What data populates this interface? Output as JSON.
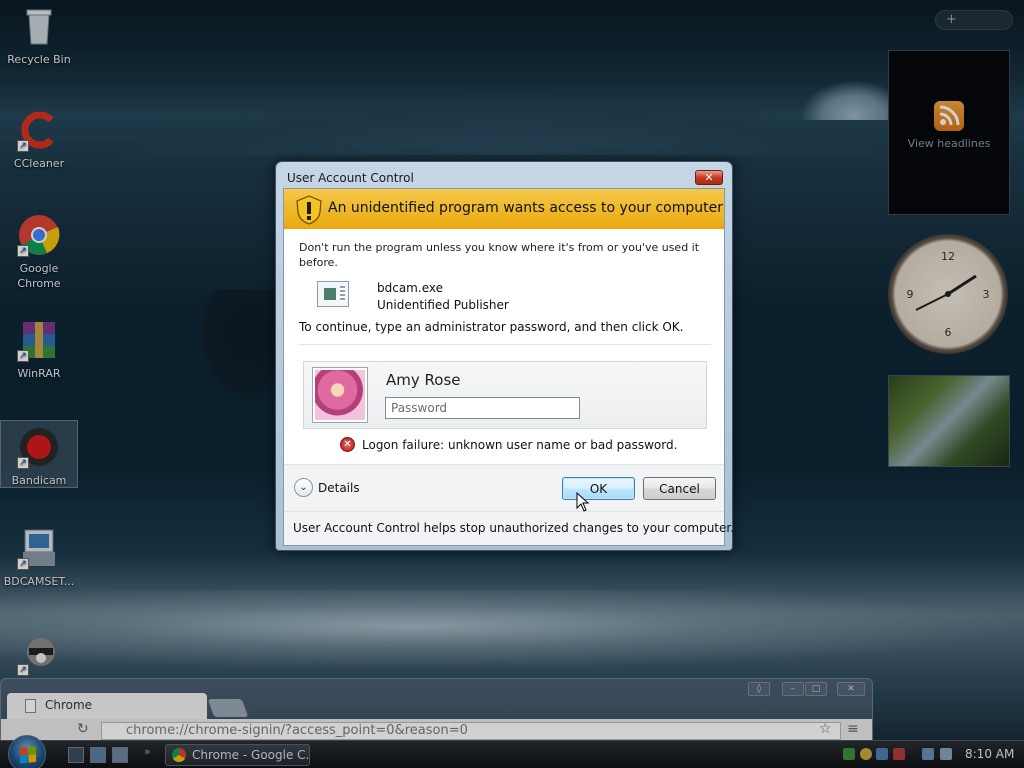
{
  "desktop": {
    "icons": [
      {
        "label": "Recycle Bin"
      },
      {
        "label": "CCleaner"
      },
      {
        "label": "Google Chrome"
      },
      {
        "label": "WinRAR"
      },
      {
        "label": "Bandicam"
      },
      {
        "label": "BDCAMSET..."
      }
    ]
  },
  "gadgets": {
    "feed_label": "View headlines",
    "feed_icon": "rss-icon"
  },
  "dialog": {
    "title": "User Account Control",
    "banner": "An unidentified program wants access to your computer",
    "warning": "Don't run the program unless you know where it's from or you've used it before.",
    "program_name": "bdcam.exe",
    "publisher": "Unidentified Publisher",
    "instruction": "To continue, type an administrator password, and then click OK.",
    "user_name": "Amy Rose",
    "password_placeholder": "Password",
    "password_value": "",
    "error": "Logon failure: unknown user name or bad password.",
    "details_label": "Details",
    "ok_label": "OK",
    "cancel_label": "Cancel",
    "footer": "User Account Control helps stop unauthorized changes to your computer.",
    "accent": "#e9a90e"
  },
  "browser": {
    "tab_title": "Chrome",
    "address": "chrome://chrome-signin/?access_point=0&reason=0"
  },
  "taskbar": {
    "task_label": "Chrome - Google C...",
    "time": "8:10 AM"
  }
}
